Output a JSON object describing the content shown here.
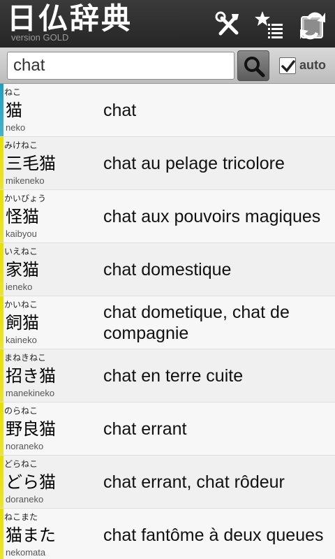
{
  "header": {
    "title": "日仏辞典",
    "version": "version GOLD",
    "icons": [
      "tools-icon",
      "favorites-list-icon",
      "switch-dictionary-icon"
    ]
  },
  "search": {
    "value": "chat",
    "auto_label": "auto",
    "auto_checked": true
  },
  "results": [
    {
      "furigana": "ねこ",
      "kanji": "猫",
      "romaji": "neko",
      "meaning": "chat",
      "color": "#1e9fc0"
    },
    {
      "furigana": "みけねこ",
      "kanji": "三毛猫",
      "romaji": "mikeneko",
      "meaning": "chat au pelage tricolore",
      "color": "#e8e000"
    },
    {
      "furigana": "かいびょう",
      "kanji": "怪猫",
      "romaji": "kaibyou",
      "meaning": "chat aux pouvoirs magiques",
      "color": "#e8e000"
    },
    {
      "furigana": "いえねこ",
      "kanji": "家猫",
      "romaji": "ieneko",
      "meaning": "chat domestique",
      "color": "#e8e000"
    },
    {
      "furigana": "かいねこ",
      "kanji": "飼猫",
      "romaji": "kaineko",
      "meaning": "chat dometique, chat de compagnie",
      "color": "#e8e000"
    },
    {
      "furigana": "まねきねこ",
      "kanji": "招き猫",
      "romaji": "manekineko",
      "meaning": "chat en terre cuite",
      "color": "#e8e000"
    },
    {
      "furigana": "のらねこ",
      "kanji": "野良猫",
      "romaji": "noraneko",
      "meaning": "chat errant",
      "color": "#e8e000"
    },
    {
      "furigana": "どらねこ",
      "kanji": "どら猫",
      "romaji": "doraneko",
      "meaning": "chat errant, chat rôdeur",
      "color": "#e8e000"
    },
    {
      "furigana": "ねこまた",
      "kanji": "猫また",
      "romaji": "nekomata",
      "meaning": "chat fantôme à deux queues",
      "color": "#e8e000"
    }
  ]
}
